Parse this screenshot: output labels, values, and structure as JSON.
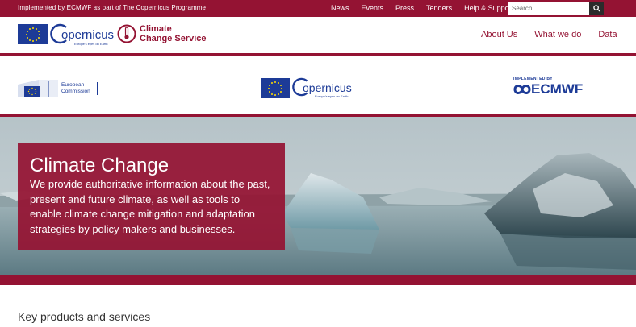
{
  "topbar": {
    "implemented_text": "Implemented by ECMWF as part of The Copernicus Programme",
    "links": [
      "News",
      "Events",
      "Press",
      "Tenders",
      "Help & Support"
    ],
    "search_placeholder": "Search"
  },
  "header": {
    "copernicus_word": "opernicus",
    "copernicus_tagline": "Europe's eyes on Earth",
    "service_line1": "Climate",
    "service_line2": "Change Service",
    "nav": [
      "About Us",
      "What we do",
      "Data"
    ]
  },
  "partners": {
    "ec_line1": "European",
    "ec_line2": "Commission",
    "copernicus_word": "opernicus",
    "copernicus_tagline": "Europe's eyes on Earth",
    "ecmwf_small": "IMPLEMENTED BY",
    "ecmwf_name": "ECMWF"
  },
  "hero": {
    "title": "Climate Change",
    "text": "We provide authoritative information about the past, present and future climate, as well as tools to enable climate change mitigation and adaptation strategies by policy makers and businesses."
  },
  "section": {
    "title": "Key products and services"
  },
  "colors": {
    "brand": "#941333",
    "eu_blue": "#1d3b97"
  }
}
